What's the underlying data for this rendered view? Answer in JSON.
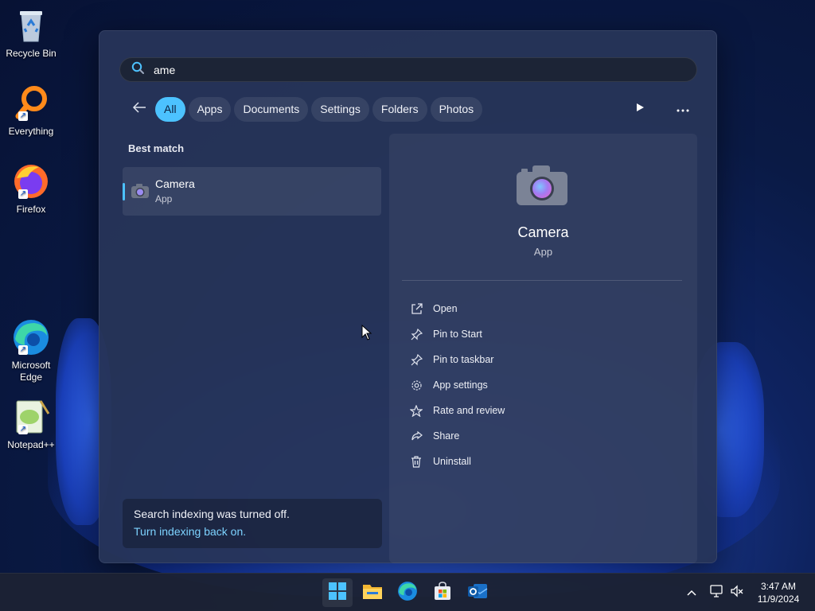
{
  "desktop": {
    "icons": [
      {
        "label": "Recycle Bin",
        "icon": "recycle-bin-icon"
      },
      {
        "label": "Everything",
        "icon": "everything-search-icon"
      },
      {
        "label": "Firefox",
        "icon": "firefox-icon"
      },
      {
        "label": "Microsoft Edge",
        "icon": "edge-icon"
      },
      {
        "label": "Notepad++",
        "icon": "notepad-plus-plus-icon"
      }
    ]
  },
  "search": {
    "query": "ame",
    "icon": "search-icon"
  },
  "filters": {
    "back_icon": "back-arrow-icon",
    "chips": [
      "All",
      "Apps",
      "Documents",
      "Settings",
      "Folders",
      "Photos"
    ],
    "active": "All",
    "play_icon": "play-icon",
    "more_icon": "more-icon"
  },
  "results": {
    "section_label": "Best match",
    "best": {
      "name": "Camera",
      "type": "App",
      "icon": "camera-icon"
    }
  },
  "indexing": {
    "message": "Search indexing was turned off.",
    "link": "Turn indexing back on."
  },
  "detail": {
    "title": "Camera",
    "subtitle": "App",
    "actions": [
      {
        "label": "Open",
        "icon": "open-external-icon"
      },
      {
        "label": "Pin to Start",
        "icon": "pin-icon"
      },
      {
        "label": "Pin to taskbar",
        "icon": "pin-icon"
      },
      {
        "label": "App settings",
        "icon": "gear-icon"
      },
      {
        "label": "Rate and review",
        "icon": "star-icon"
      },
      {
        "label": "Share",
        "icon": "share-icon"
      },
      {
        "label": "Uninstall",
        "icon": "trash-icon"
      }
    ]
  },
  "taskbar": {
    "apps": [
      "start-icon",
      "file-explorer-icon",
      "edge-icon",
      "microsoft-store-icon",
      "outlook-icon"
    ],
    "tray": [
      "chevron-up-icon",
      "network-icon",
      "volume-muted-icon"
    ],
    "time": "3:47 AM",
    "date": "11/9/2024"
  },
  "colors": {
    "accent": "#4cc2ff",
    "link": "#7dd3ff"
  }
}
